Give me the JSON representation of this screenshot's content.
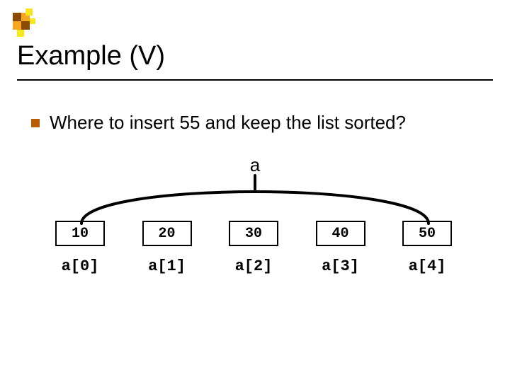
{
  "title": "Example (V)",
  "bullet_text": "Where to insert 55 and keep the list sorted?",
  "array_label": "a",
  "cells": [
    "10",
    "20",
    "30",
    "40",
    "50"
  ],
  "indices": [
    "a[0]",
    "a[1]",
    "a[2]",
    "a[3]",
    "a[4]"
  ],
  "logo_colors": {
    "dark": "#8a4a00",
    "orange": "#f5a623",
    "yellow": "#f8e71c"
  }
}
